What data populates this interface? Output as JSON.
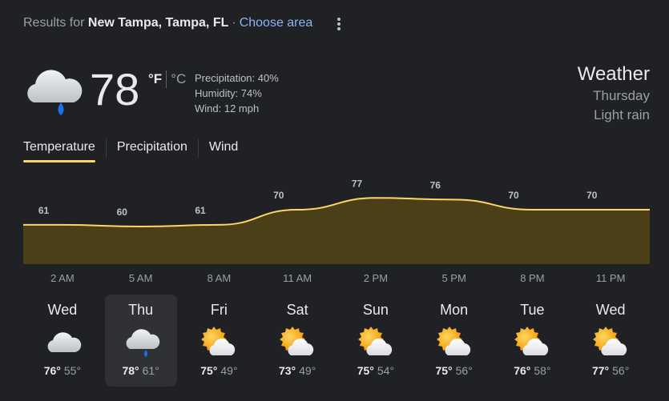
{
  "header": {
    "results_prefix": "Results for",
    "location": "New Tampa, Tampa, FL",
    "separator": "·",
    "choose_area": "Choose area"
  },
  "current": {
    "icon": "rain-cloud-icon",
    "temp": "78",
    "unit_f": "°F",
    "unit_c": "°C",
    "precipitation": "Precipitation: 40%",
    "humidity": "Humidity: 74%",
    "wind": "Wind: 12 mph"
  },
  "summary": {
    "title": "Weather",
    "day": "Thursday",
    "condition": "Light rain"
  },
  "tabs": [
    {
      "label": "Temperature",
      "active": true
    },
    {
      "label": "Precipitation",
      "active": false
    },
    {
      "label": "Wind",
      "active": false
    }
  ],
  "colors": {
    "line": "#fdd663",
    "fill": "#4b3f17",
    "accent_link": "#8ab4f8",
    "background": "#202124"
  },
  "chart_data": {
    "type": "area",
    "x": [
      "2 AM",
      "5 AM",
      "8 AM",
      "11 AM",
      "2 PM",
      "5 PM",
      "8 PM",
      "11 PM"
    ],
    "values": [
      61,
      60,
      61,
      70,
      77,
      76,
      70,
      70
    ],
    "labels": [
      "61",
      "60",
      "61",
      "70",
      "77",
      "76",
      "70",
      "70"
    ],
    "ylim": [
      40,
      90
    ]
  },
  "days": [
    {
      "name": "Wed",
      "icon": "cloudy-icon",
      "hi": "76°",
      "lo": "55°",
      "selected": false
    },
    {
      "name": "Thu",
      "icon": "rain-cloud-icon",
      "hi": "78°",
      "lo": "61°",
      "selected": true
    },
    {
      "name": "Fri",
      "icon": "partly-cloudy-icon",
      "hi": "75°",
      "lo": "49°",
      "selected": false
    },
    {
      "name": "Sat",
      "icon": "partly-cloudy-icon",
      "hi": "73°",
      "lo": "49°",
      "selected": false
    },
    {
      "name": "Sun",
      "icon": "partly-cloudy-icon",
      "hi": "75°",
      "lo": "54°",
      "selected": false
    },
    {
      "name": "Mon",
      "icon": "partly-cloudy-icon",
      "hi": "75°",
      "lo": "56°",
      "selected": false
    },
    {
      "name": "Tue",
      "icon": "partly-cloudy-icon",
      "hi": "76°",
      "lo": "58°",
      "selected": false
    },
    {
      "name": "Wed",
      "icon": "partly-cloudy-icon",
      "hi": "77°",
      "lo": "56°",
      "selected": false
    }
  ]
}
